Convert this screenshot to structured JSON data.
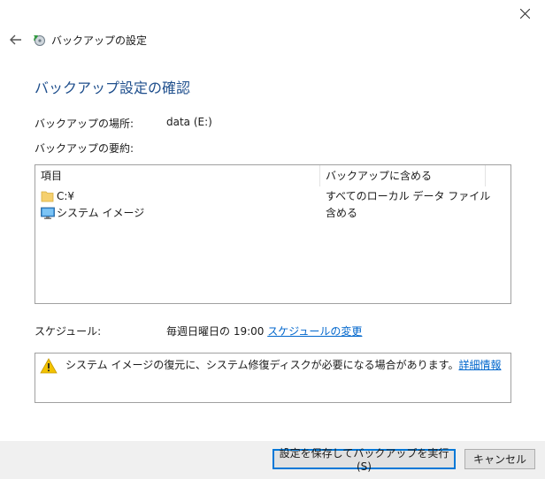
{
  "window": {
    "nav_title": "バックアップの設定",
    "icons": {
      "close": "close-icon",
      "back": "back-arrow-icon",
      "app": "backup-restore-icon"
    }
  },
  "main": {
    "title": "バックアップ設定の確認",
    "location_label": "バックアップの場所:",
    "location_value": "data (E:)",
    "summary_label": "バックアップの要約:"
  },
  "summary_table": {
    "columns": [
      "項目",
      "バックアップに含める"
    ],
    "rows": [
      {
        "icon": "folder-icon",
        "item": "C:¥",
        "include": "すべてのローカル データ ファイル"
      },
      {
        "icon": "monitor-icon",
        "item": "システム イメージ",
        "include": "含める"
      }
    ]
  },
  "schedule": {
    "label": "スケジュール:",
    "value": "毎週日曜日の 19:00",
    "change_link": "スケジュールの変更"
  },
  "warning": {
    "icon": "warning-icon",
    "text": "システム イメージの復元に、システム修復ディスクが必要になる場合があります。",
    "link": "詳細情報"
  },
  "footer": {
    "save_run_label": "設定を保存してバックアップを実行(S)",
    "cancel_label": "キャンセル"
  },
  "colors": {
    "title": "#1e4e8c",
    "link": "#0066cc",
    "footer_bg": "#f0f0f0",
    "warning": "#f2c200",
    "folder": "#f5d06f",
    "primary_border": "#0078d7"
  }
}
